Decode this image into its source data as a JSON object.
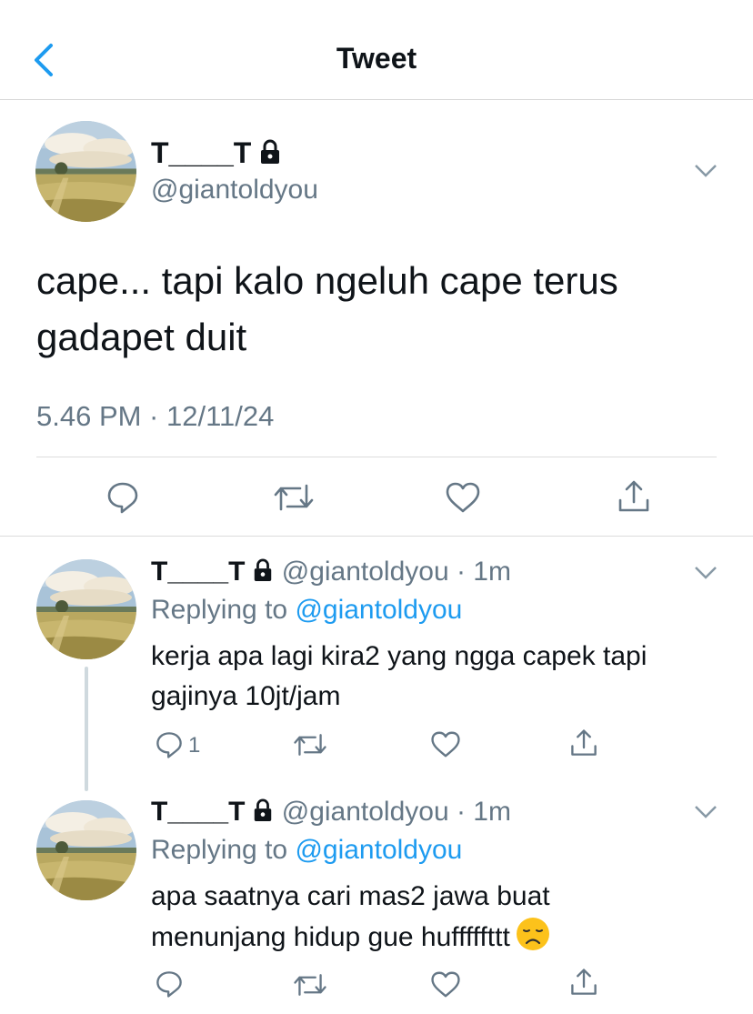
{
  "header": {
    "title": "Tweet",
    "back_icon": "chevron-left-icon",
    "accent": "#1d9bf0"
  },
  "tweet": {
    "name": "T____T",
    "handle": "@giantoldyou",
    "text_line1": "cape... tapi kalo ngeluh cape terus",
    "text_line2": "gadapet duit",
    "timestamp": "5.46 PM · 12/11/24",
    "actions": [
      "reply-icon",
      "retweet-icon",
      "like-icon",
      "share-icon"
    ]
  },
  "replies": [
    {
      "name": "T____T",
      "handle_time": "@giantoldyou · 1m",
      "replying_prefix": "Replying to ",
      "replying_to": "@giantoldyou",
      "text_line1": "kerja apa lagi kira2 yang ngga capek tapi",
      "text_line2": "gajinya 10jt/jam",
      "reply_count": "1"
    },
    {
      "name": "T____T",
      "handle_time": "@giantoldyou · 1m",
      "replying_prefix": "Replying to ",
      "replying_to": "@giantoldyou",
      "text_line1": "apa saatnya cari mas2 jawa buat",
      "text_line2": "menunjang hidup gue hufffffttt",
      "emoji": "disappointed-face"
    }
  ],
  "colors": {
    "text": "#0f1419",
    "muted": "#657786",
    "link": "#1d9bf0",
    "divider": "#dcdcdc"
  }
}
